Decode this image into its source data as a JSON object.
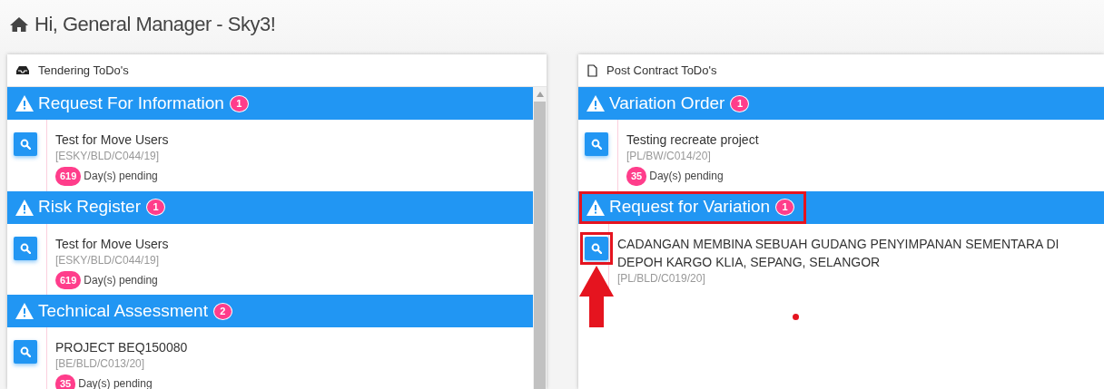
{
  "greeting": "Hi, General Manager - Sky3!",
  "panels": [
    {
      "title": "Tendering ToDo's",
      "scrollbar": true,
      "sections": [
        {
          "title": "Request For Information",
          "count": "1",
          "items": [
            {
              "title": "Test for Move Users",
              "ref": "[ESKY/BLD/C044/19]",
              "days": "619",
              "days_label": "Day(s) pending"
            }
          ]
        },
        {
          "title": "Risk Register",
          "count": "1",
          "items": [
            {
              "title": "Test for Move Users",
              "ref": "[ESKY/BLD/C044/19]",
              "days": "619",
              "days_label": "Day(s) pending"
            }
          ]
        },
        {
          "title": "Technical Assessment",
          "count": "2",
          "items": [
            {
              "title": "PROJECT BEQ150080",
              "ref": "[BE/BLD/C013/20]",
              "days": "35",
              "days_label": "Day(s) pending"
            }
          ]
        }
      ]
    },
    {
      "title": "Post Contract ToDo's",
      "sections": [
        {
          "title": "Variation Order",
          "count": "1",
          "items": [
            {
              "title": "Testing recreate project",
              "ref": "[PL/BW/C014/20]",
              "days": "35",
              "days_label": "Day(s) pending"
            }
          ]
        },
        {
          "title": "Request for Variation",
          "count": "1",
          "highlighted": true,
          "items": [
            {
              "title": "CADANGAN MEMBINA SEBUAH GUDANG PENYIMPANAN SEMENTARA DI DEPOH KARGO KLIA, SEPANG, SELANGOR",
              "ref": "[PL/BLD/C019/20]",
              "highlighted": true,
              "arrow": true
            }
          ]
        }
      ],
      "annotations": [
        {
          "kind": "dot"
        }
      ]
    }
  ]
}
